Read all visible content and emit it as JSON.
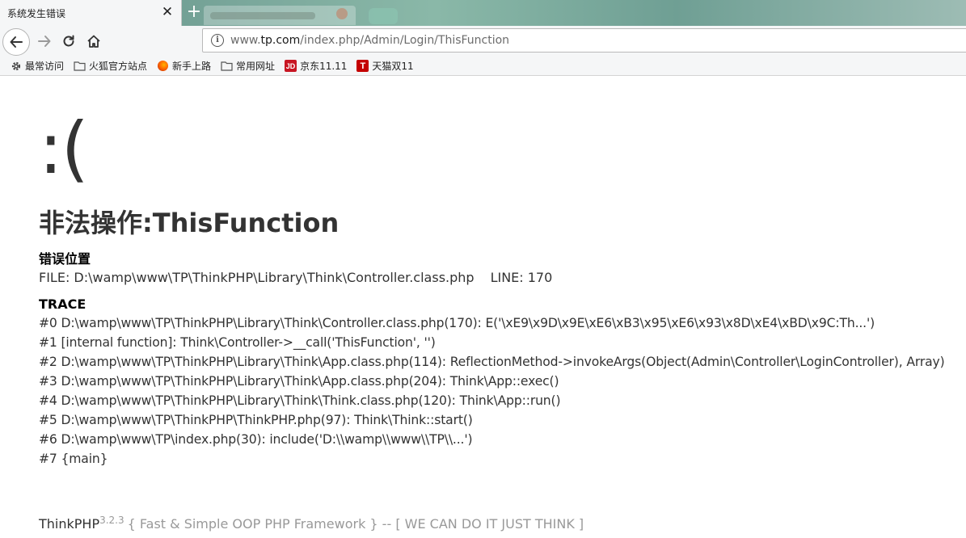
{
  "browser": {
    "active_tab": {
      "title": "系统发生错误",
      "close_glyph": "✕"
    },
    "new_tab_glyph": "+",
    "url": {
      "prefix": "www.",
      "host": "tp.com",
      "path": "/index.php/Admin/Login/ThisFunction",
      "info_glyph": "i"
    },
    "bookmarks": [
      {
        "label": "最常访问",
        "icon": "gear-icon"
      },
      {
        "label": "火狐官方站点",
        "icon": "folder-icon"
      },
      {
        "label": "新手上路",
        "icon": "firefox-icon"
      },
      {
        "label": "常用网址",
        "icon": "folder-icon"
      },
      {
        "label": "京东11.11",
        "icon": "jd-icon",
        "icon_text": "JD"
      },
      {
        "label": "天猫双11",
        "icon": "tmall-icon",
        "icon_text": "T"
      }
    ]
  },
  "error": {
    "face": ":(",
    "title": "非法操作:ThisFunction",
    "location_heading": "错误位置",
    "file_label": "FILE: D:\\wamp\\www\\TP\\ThinkPHP\\Library\\Think\\Controller.class.php",
    "line_label": "LINE: 170",
    "trace_heading": "TRACE",
    "trace": [
      "#0 D:\\wamp\\www\\TP\\ThinkPHP\\Library\\Think\\Controller.class.php(170): E('\\xE9\\x9D\\x9E\\xE6\\xB3\\x95\\xE6\\x93\\x8D\\xE4\\xBD\\x9C:Th...')",
      "#1 [internal function]: Think\\Controller->__call('ThisFunction', '')",
      "#2 D:\\wamp\\www\\TP\\ThinkPHP\\Library\\Think\\App.class.php(114): ReflectionMethod->invokeArgs(Object(Admin\\Controller\\LoginController), Array)",
      "#3 D:\\wamp\\www\\TP\\ThinkPHP\\Library\\Think\\App.class.php(204): Think\\App::exec()",
      "#4 D:\\wamp\\www\\TP\\ThinkPHP\\Library\\Think\\Think.class.php(120): Think\\App::run()",
      "#5 D:\\wamp\\www\\TP\\ThinkPHP\\ThinkPHP.php(97): Think\\Think::start()",
      "#6 D:\\wamp\\www\\TP\\index.php(30): include('D:\\\\wamp\\\\www\\\\TP\\\\...')",
      "#7 {main}"
    ]
  },
  "footer": {
    "name": "ThinkPHP",
    "version": "3.2.3",
    "slogan": "{ Fast & Simple OOP PHP Framework } -- [ WE CAN DO IT JUST THINK ]"
  },
  "colors": {
    "tab_gradient_start": "#5c8d83",
    "toolbar_bg": "#f5f6f7",
    "text": "#333333",
    "muted": "#999999"
  }
}
